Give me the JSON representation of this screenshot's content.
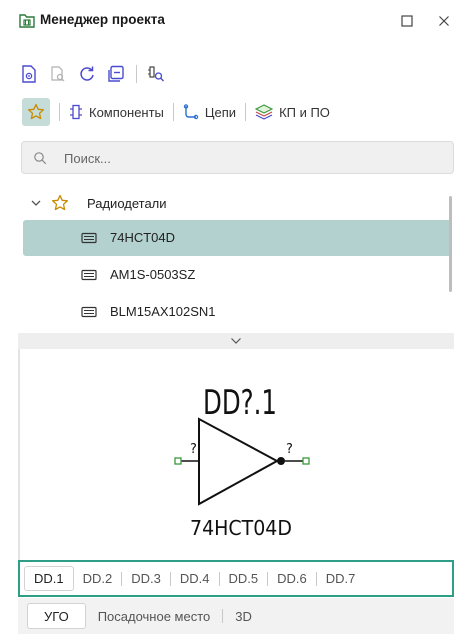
{
  "window": {
    "title": "Менеджер проекта",
    "maximize_icon": "maximize-icon",
    "close_icon": "close-icon"
  },
  "toolbar": {
    "icons": [
      "open-document-icon",
      "search-document-icon",
      "refresh-icon",
      "collapse-all-icon",
      "find-component-icon"
    ]
  },
  "filter_tabs": {
    "favorites_icon": "star-icon",
    "items": [
      {
        "label": "Компоненты",
        "icon": "component-icon"
      },
      {
        "label": "Цепи",
        "icon": "net-icon"
      },
      {
        "label": "КП и ПО",
        "icon": "pads-vias-icon"
      }
    ]
  },
  "search": {
    "placeholder": "Поиск...",
    "value": ""
  },
  "tree": {
    "group_label": "Радиодетали",
    "items": [
      {
        "label": "74HCT04D",
        "selected": true
      },
      {
        "label": "AM1S-0503SZ",
        "selected": false
      },
      {
        "label": "BLM15AX102SN1",
        "selected": false
      }
    ]
  },
  "preview": {
    "refdes": "DD?.1",
    "pin_in": "?",
    "pin_out": "?",
    "part_name": "74HCT04D"
  },
  "part_tabs": [
    "DD.1",
    "DD.2",
    "DD.3",
    "DD.4",
    "DD.5",
    "DD.6",
    "DD.7"
  ],
  "view_tabs": [
    "УГО",
    "Посадочное место",
    "3D"
  ],
  "colors": {
    "accent": "#2e9e86",
    "selection": "#b2d1cf",
    "pin_green": "#3a9a3a"
  }
}
